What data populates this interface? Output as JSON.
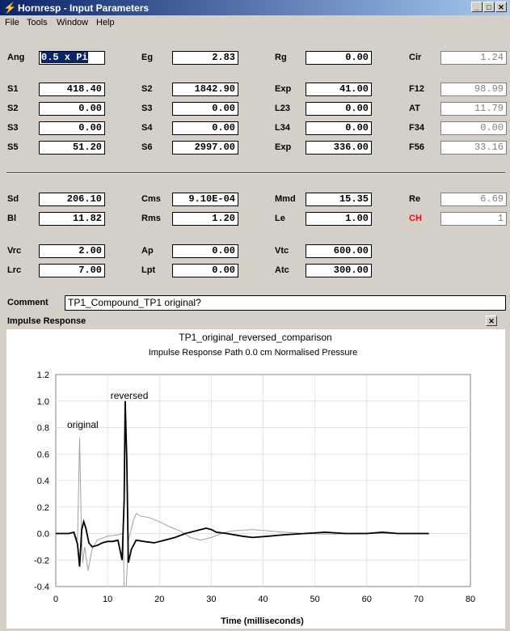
{
  "window": {
    "title": "Hornresp - Input Parameters",
    "subwindow_title": "Impulse Response"
  },
  "menu": [
    "File",
    "Tools",
    "Window",
    "Help"
  ],
  "params": {
    "col1": [
      {
        "label": "Ang",
        "value": "0.5 x Pi"
      },
      {
        "label": "S1",
        "value": "418.40"
      },
      {
        "label": "S2",
        "value": "0.00"
      },
      {
        "label": "S3",
        "value": "0.00"
      },
      {
        "label": "S5",
        "value": "51.20"
      },
      {
        "label": "Sd",
        "value": "206.10"
      },
      {
        "label": "Bl",
        "value": "11.82"
      },
      {
        "label": "Vrc",
        "value": "2.00"
      },
      {
        "label": "Lrc",
        "value": "7.00"
      }
    ],
    "col2": [
      {
        "label": "Eg",
        "value": "2.83"
      },
      {
        "label": "S2",
        "value": "1842.90"
      },
      {
        "label": "S3",
        "value": "0.00"
      },
      {
        "label": "S4",
        "value": "0.00"
      },
      {
        "label": "S6",
        "value": "2997.00"
      },
      {
        "label": "Cms",
        "value": "9.10E-04"
      },
      {
        "label": "Rms",
        "value": "1.20"
      },
      {
        "label": "Ap",
        "value": "0.00"
      },
      {
        "label": "Lpt",
        "value": "0.00"
      }
    ],
    "col3": [
      {
        "label": "Rg",
        "value": "0.00"
      },
      {
        "label": "Exp",
        "value": "41.00"
      },
      {
        "label": "L23",
        "value": "0.00"
      },
      {
        "label": "L34",
        "value": "0.00"
      },
      {
        "label": "Exp",
        "value": "336.00"
      },
      {
        "label": "Mmd",
        "value": "15.35"
      },
      {
        "label": "Le",
        "value": "1.00"
      },
      {
        "label": "Vtc",
        "value": "600.00"
      },
      {
        "label": "Atc",
        "value": "300.00"
      }
    ],
    "col4": [
      {
        "label": "Cir",
        "value": "1.24"
      },
      {
        "label": "F12",
        "value": "98.99"
      },
      {
        "label": "AT",
        "value": "11.79"
      },
      {
        "label": "F34",
        "value": "0.00"
      },
      {
        "label": "F56",
        "value": "33.16"
      },
      {
        "label": "Re",
        "value": "6.69"
      },
      {
        "label": "CH",
        "value": "1"
      }
    ]
  },
  "comment": {
    "label": "Comment",
    "value": "TP1_Compound_TP1 original?"
  },
  "colors": {
    "titlebar": "#0a246a",
    "ch_label": "#ff0000",
    "trace_reversed": "#000000",
    "trace_original": "#a0a0a0"
  },
  "chart_data": {
    "type": "line",
    "title": "TP1_original_reversed_comparison",
    "subtitle": "Impulse Response   Path 0.0 cm   Normalised Pressure",
    "xlabel": "Time (milliseconds)",
    "ylabel": "",
    "xlim": [
      0,
      80
    ],
    "ylim": [
      -0.4,
      1.2
    ],
    "xticks": [
      0,
      10,
      20,
      30,
      40,
      50,
      60,
      70,
      80
    ],
    "yticks": [
      1.2,
      1.0,
      0.8,
      0.6,
      0.4,
      0.2,
      0.0,
      -0.2,
      -0.4
    ],
    "grid": true,
    "annotations": [
      {
        "text": "original",
        "x": 5.2,
        "y": 0.82
      },
      {
        "text": "reversed",
        "x": 14.2,
        "y": 1.04
      }
    ],
    "series": [
      {
        "name": "original",
        "values": [
          [
            0,
            0
          ],
          [
            2.5,
            0
          ],
          [
            3.5,
            0.01
          ],
          [
            4.2,
            -0.05
          ],
          [
            4.6,
            0.72
          ],
          [
            4.9,
            0.1
          ],
          [
            5.2,
            -0.22
          ],
          [
            5.6,
            -0.1
          ],
          [
            6.2,
            -0.28
          ],
          [
            7,
            -0.12
          ],
          [
            8,
            -0.05
          ],
          [
            10,
            -0.02
          ],
          [
            12,
            -0.01
          ],
          [
            13,
            0.0
          ],
          [
            13.2,
            -0.4
          ],
          [
            13.6,
            -0.4
          ],
          [
            14,
            -0.05
          ],
          [
            15,
            0.1
          ],
          [
            15.5,
            0.15
          ],
          [
            16.5,
            0.13
          ],
          [
            18,
            0.12
          ],
          [
            20,
            0.09
          ],
          [
            22,
            0.05
          ],
          [
            24,
            0.02
          ],
          [
            26,
            -0.03
          ],
          [
            28,
            -0.05
          ],
          [
            30,
            -0.03
          ],
          [
            32,
            0.0
          ],
          [
            34,
            0.02
          ],
          [
            38,
            0.03
          ],
          [
            41,
            0.02
          ],
          [
            44,
            0.01
          ],
          [
            48,
            0.0
          ],
          [
            52,
            -0.005
          ],
          [
            60,
            0.0
          ],
          [
            70,
            0.0
          ],
          [
            72,
            0
          ]
        ]
      },
      {
        "name": "reversed",
        "values": [
          [
            0,
            0
          ],
          [
            2.5,
            0
          ],
          [
            3.5,
            0.01
          ],
          [
            4.2,
            -0.08
          ],
          [
            4.6,
            -0.25
          ],
          [
            5.0,
            0.03
          ],
          [
            5.4,
            0.09
          ],
          [
            5.8,
            0.04
          ],
          [
            6.4,
            -0.07
          ],
          [
            7,
            -0.1
          ],
          [
            8,
            -0.09
          ],
          [
            9,
            -0.07
          ],
          [
            10,
            -0.06
          ],
          [
            11,
            -0.06
          ],
          [
            12,
            -0.05
          ],
          [
            12.8,
            -0.2
          ],
          [
            13.2,
            0.25
          ],
          [
            13.4,
            1.0
          ],
          [
            13.7,
            0.55
          ],
          [
            14,
            -0.22
          ],
          [
            14.6,
            -0.12
          ],
          [
            15.5,
            -0.05
          ],
          [
            17,
            -0.06
          ],
          [
            19,
            -0.07
          ],
          [
            21,
            -0.05
          ],
          [
            23,
            -0.03
          ],
          [
            25,
            0.0
          ],
          [
            27,
            0.02
          ],
          [
            29,
            0.04
          ],
          [
            30,
            0.03
          ],
          [
            31,
            0.01
          ],
          [
            33,
            0.0
          ],
          [
            36,
            -0.02
          ],
          [
            38,
            -0.03
          ],
          [
            41,
            -0.02
          ],
          [
            44,
            -0.01
          ],
          [
            48,
            0.0
          ],
          [
            52,
            0.01
          ],
          [
            56,
            0.0
          ],
          [
            60,
            0.0
          ],
          [
            63,
            0.01
          ],
          [
            66,
            0.0
          ],
          [
            70,
            0.0
          ],
          [
            72,
            0
          ]
        ]
      }
    ]
  }
}
